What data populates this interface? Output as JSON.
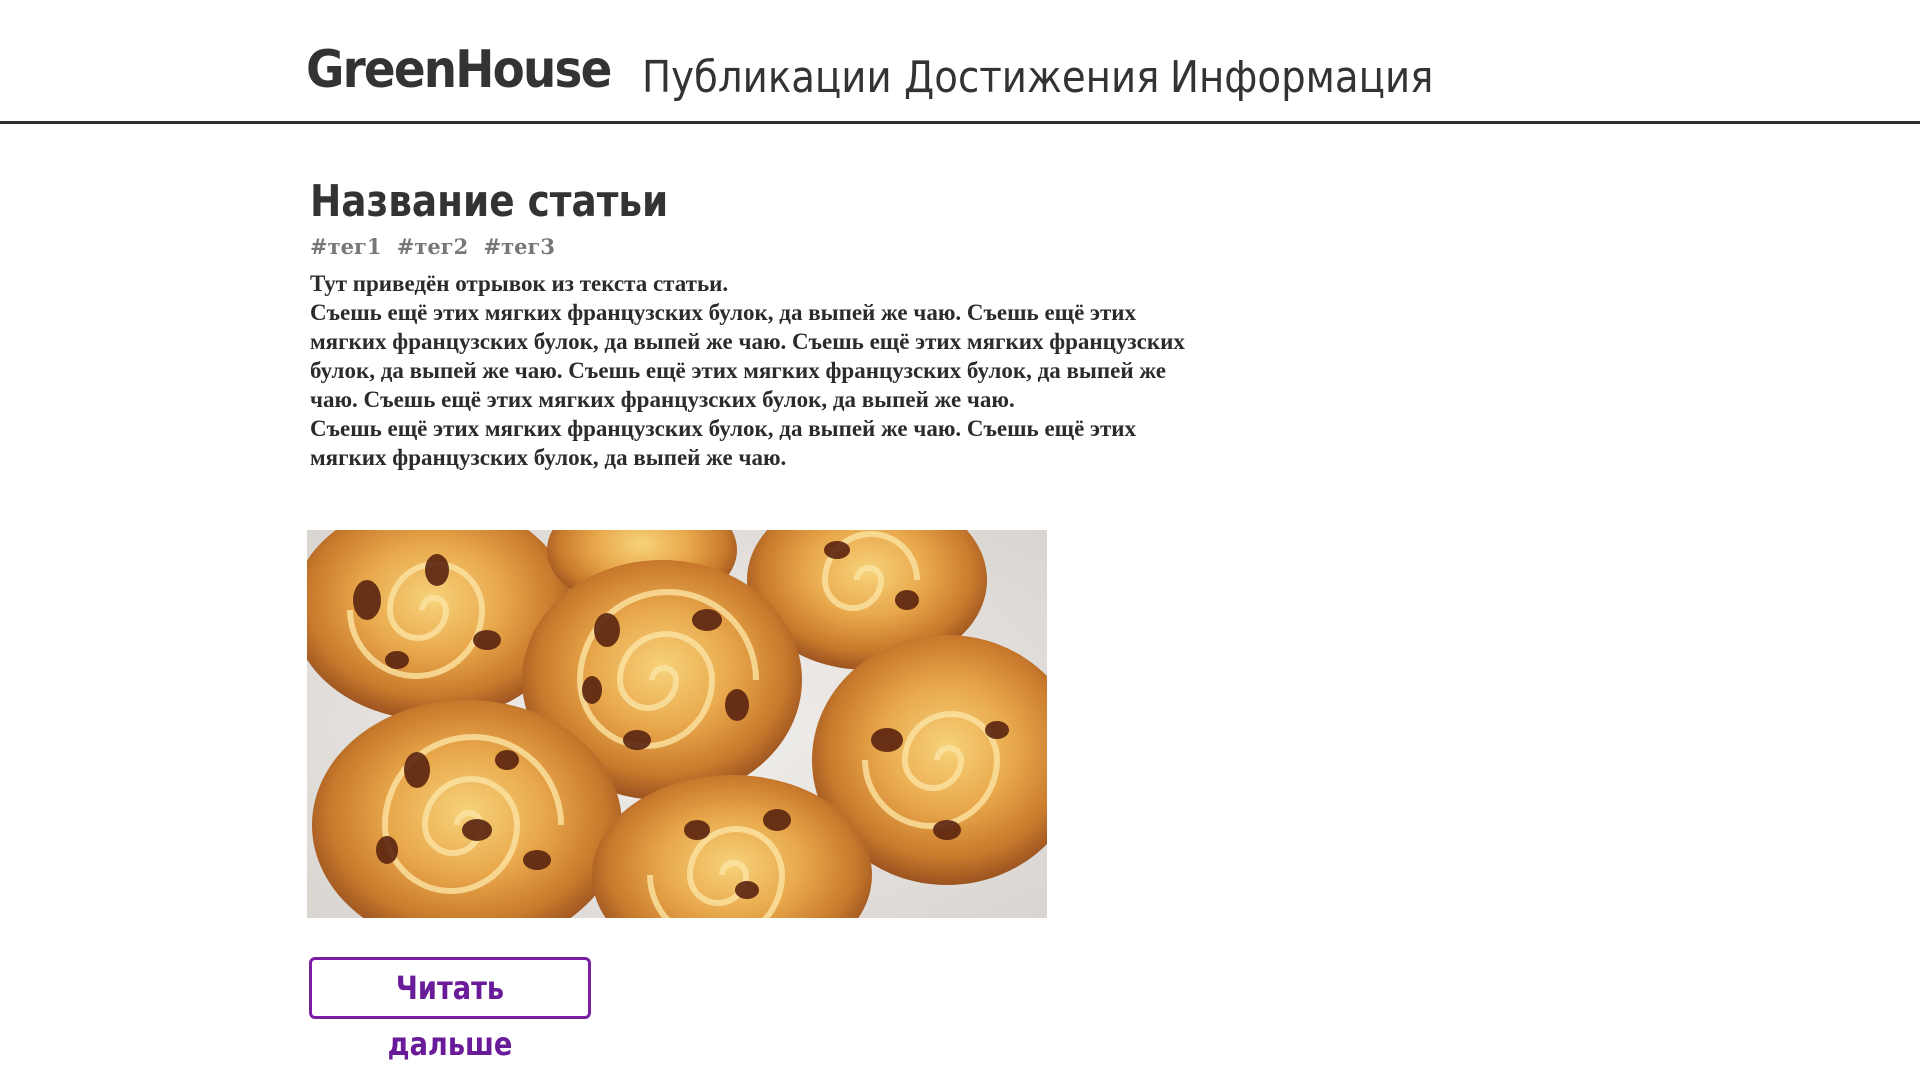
{
  "header": {
    "logo": "GreenHouse",
    "nav": [
      {
        "label": "Публикации"
      },
      {
        "label": "Достижения"
      },
      {
        "label": "Информация"
      }
    ]
  },
  "article": {
    "title": "Название статьи",
    "tags": [
      "#тег1",
      "#тег2",
      "#тег3"
    ],
    "paragraphs": [
      "Тут приведён отрывок из текста статьи.",
      "Съешь ещё этих мягких французских булок, да выпей же чаю. Съешь ещё этих мягких французских булок, да выпей же чаю. Съешь ещё этих мягких французских булок, да выпей же чаю. Съешь ещё этих мягких французских булок, да выпей же чаю. Съешь ещё этих мягких французских булок, да выпей же чаю.",
      "Съешь ещё этих мягких французских булок, да выпей же чаю. Съешь ещё этих мягких французских булок, да выпей же чаю."
    ],
    "read_more_label": "Читать дальше"
  },
  "colors": {
    "accent": "#7b1fa2",
    "text": "#333333",
    "tag": "#777777"
  }
}
